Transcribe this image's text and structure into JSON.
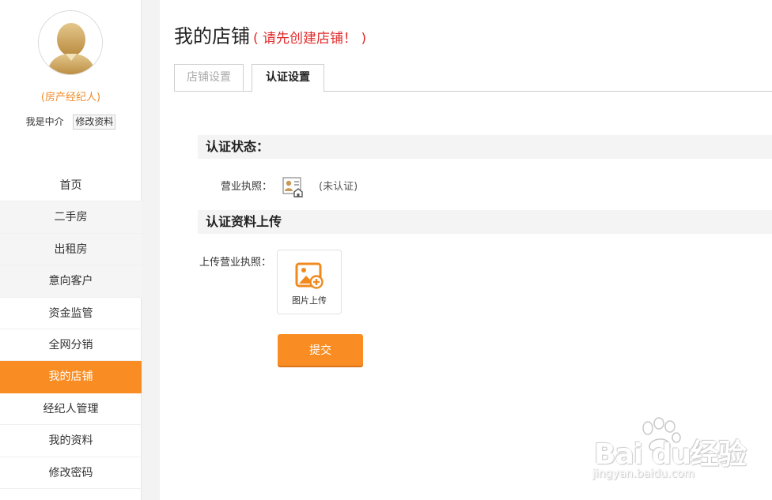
{
  "sidebar": {
    "role": "(房产经纪人)",
    "user_type": "我是中介",
    "edit_profile": "修改资料",
    "nav": [
      {
        "label": "首页"
      },
      {
        "label": "二手房"
      },
      {
        "label": "出租房"
      },
      {
        "label": "意向客户"
      },
      {
        "label": "资金监管"
      },
      {
        "label": "全网分销"
      },
      {
        "label": "我的店铺"
      },
      {
        "label": "经纪人管理"
      },
      {
        "label": "我的资料"
      },
      {
        "label": "修改密码"
      }
    ],
    "active_item": "我的店铺"
  },
  "main": {
    "title": "我的店铺",
    "title_warning": "( 请先创建店铺！ )",
    "tabs": [
      {
        "label": "店铺设置"
      },
      {
        "label": "认证设置"
      }
    ],
    "selected_tab": "认证设置",
    "section_status": "认证状态：",
    "license_label": "营业执照：",
    "license_icon": "license-card-icon",
    "license_status": "(未认证)",
    "section_upload": "认证资料上传",
    "upload_label": "上传营业执照：",
    "upload_icon": "image-add-icon",
    "upload_button": "图片上传",
    "submit": "提交"
  },
  "watermark": {
    "brand": "Bai du经验",
    "url": "jingyan.baidu.com"
  },
  "colors": {
    "accent": "#f98d23",
    "role_text": "#f08c2a",
    "warning": "#e12b2b"
  }
}
